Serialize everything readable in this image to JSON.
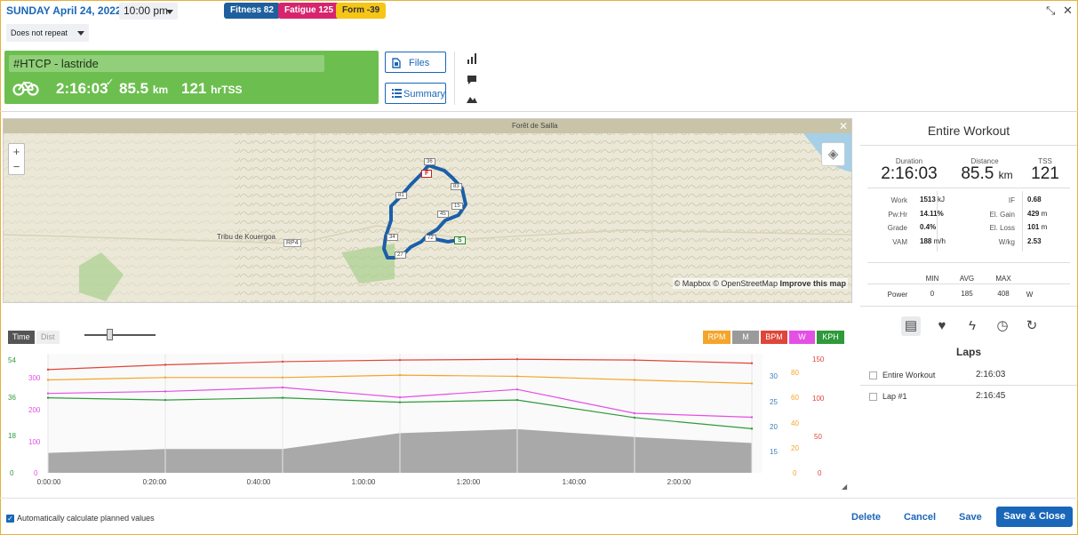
{
  "header": {
    "date": "SUNDAY April 24, 2022",
    "time": "10:00 pm",
    "repeat": "Does not repeat",
    "badges": [
      {
        "label": "Fitness 82",
        "bg": "#1f5f9e",
        "fg": "#ffffff"
      },
      {
        "label": "Fatigue 125",
        "bg": "#d6246e",
        "fg": "#ffffff"
      },
      {
        "label": "Form -39",
        "bg": "#f5c518",
        "fg": "#333333"
      }
    ]
  },
  "card": {
    "title": "#HTCP - lastride",
    "duration": "2:16:03",
    "distance": "85.5",
    "distance_unit": "km",
    "tss": "121",
    "tss_unit": "hrTSS",
    "color": "#6cbf4f",
    "icon": "bike-icon"
  },
  "buttons": {
    "files": "Files",
    "summary": "Summary"
  },
  "map": {
    "top_label": "Forêt de Sailla",
    "place_label": "Tribu de Kouergoa",
    "road_label": "RP4",
    "attribution_a": "© Mapbox © OpenStreetMap",
    "attribution_b": "Improve this map",
    "markers": [
      "36",
      "F",
      "81",
      "83",
      "15",
      "45",
      "34",
      "72",
      "S",
      "27"
    ]
  },
  "chart": {
    "toggle_time": "Time",
    "toggle_dist": "Dist",
    "legend": [
      {
        "label": "RPM",
        "color": "#f4a52a"
      },
      {
        "label": "M",
        "color": "#9a9a9a"
      },
      {
        "label": "BPM",
        "color": "#e0453a"
      },
      {
        "label": "W",
        "color": "#e44fe4"
      },
      {
        "label": "KPH",
        "color": "#2e9a3a"
      }
    ],
    "y_left_green": [
      "54",
      "36",
      "18",
      "0"
    ],
    "y_left_pink": [
      "300",
      "200",
      "100",
      "0"
    ],
    "y_right_blue": [
      "30",
      "25",
      "20",
      "15"
    ],
    "y_right_orange": [
      "80",
      "60",
      "40",
      "20",
      "0"
    ],
    "y_right_red": [
      "150",
      "100",
      "50",
      "0"
    ],
    "x_labels": [
      "0:00:00",
      "0:20:00",
      "0:40:00",
      "1:00:00",
      "1:20:00",
      "1:40:00",
      "2:00:00"
    ]
  },
  "chart_data": {
    "type": "line",
    "xlabel": "",
    "ylabel": "",
    "x": [
      "0:00:00",
      "0:20:00",
      "0:40:00",
      "1:00:00",
      "1:20:00",
      "1:40:00",
      "2:00:00"
    ],
    "series": [
      {
        "name": "BPM",
        "color": "#e0453a",
        "values": [
          130,
          136,
          140,
          142,
          143,
          142,
          138
        ]
      },
      {
        "name": "RPM",
        "color": "#f4a52a",
        "values": [
          78,
          80,
          80,
          82,
          81,
          78,
          75
        ]
      },
      {
        "name": "KPH",
        "color": "#2e9a3a",
        "values": [
          34,
          33,
          34,
          32,
          33,
          25,
          20
        ]
      },
      {
        "name": "W",
        "color": "#e44fe4",
        "values": [
          200,
          205,
          215,
          190,
          210,
          150,
          140
        ]
      },
      {
        "name": "M",
        "color": "#9a9a9a",
        "values": [
          10,
          12,
          12,
          20,
          22,
          18,
          15
        ]
      }
    ]
  },
  "panel": {
    "title": "Entire Workout",
    "stats": [
      {
        "label": "Duration",
        "value": "2:16:03",
        "unit": ""
      },
      {
        "label": "Distance",
        "value": "85.5",
        "unit": "km"
      },
      {
        "label": "TSS",
        "value": "121",
        "unit": ""
      }
    ],
    "metrics_left": [
      {
        "label": "Work",
        "value": "1513",
        "unit": "kJ"
      },
      {
        "label": "Pw:Hr",
        "value": "14.11%",
        "unit": ""
      },
      {
        "label": "Grade",
        "value": "0.4%",
        "unit": ""
      },
      {
        "label": "VAM",
        "value": "188",
        "unit": "m/h"
      }
    ],
    "metrics_right": [
      {
        "label": "IF",
        "value": "0.68",
        "unit": ""
      },
      {
        "label": "El. Gain",
        "value": "429",
        "unit": "m"
      },
      {
        "label": "El. Loss",
        "value": "101",
        "unit": "m"
      },
      {
        "label": "W/kg",
        "value": "2.53",
        "unit": ""
      }
    ],
    "table": {
      "headers": [
        "MIN",
        "AVG",
        "MAX"
      ],
      "row_label": "Power",
      "row_values": [
        "0",
        "185",
        "408"
      ],
      "row_unit": "W"
    },
    "laps_title": "Laps",
    "laps": [
      {
        "name": "Entire Workout",
        "time": "2:16:03"
      },
      {
        "name": "Lap #1",
        "time": "2:16:45"
      }
    ]
  },
  "footer": {
    "auto_calc": "Automatically calculate planned values",
    "delete": "Delete",
    "cancel": "Cancel",
    "save": "Save",
    "save_close": "Save & Close"
  }
}
